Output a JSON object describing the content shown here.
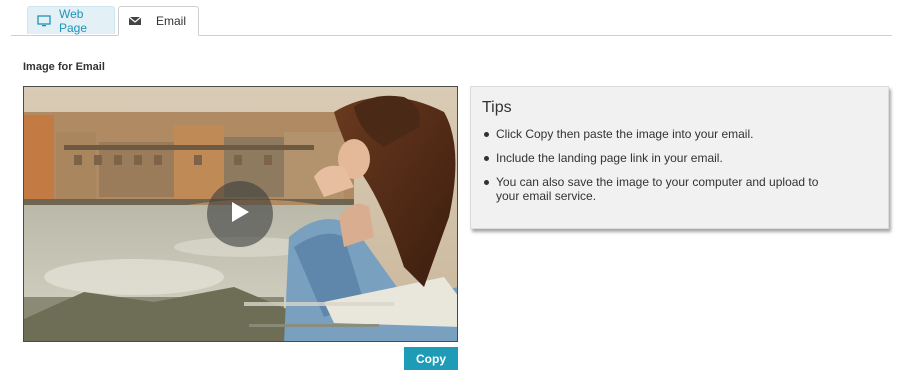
{
  "tabs": [
    {
      "label": "Web Page",
      "icon": "monitor-icon",
      "active": false
    },
    {
      "label": "Email",
      "icon": "envelope-icon",
      "active": true
    }
  ],
  "section": {
    "label": "Image for Email"
  },
  "video": {
    "play_icon": "play-icon"
  },
  "actions": {
    "copy_label": "Copy"
  },
  "tips": {
    "title": "Tips",
    "items": [
      "Click Copy then paste the image into your email.",
      "Include the landing page link in your email.",
      "You can also save the image to your computer and upload to your email service."
    ]
  },
  "colors": {
    "accent": "#1d9bb7",
    "tab_active_bg": "#e3f1f6",
    "tips_bg": "#f1f1f1"
  }
}
